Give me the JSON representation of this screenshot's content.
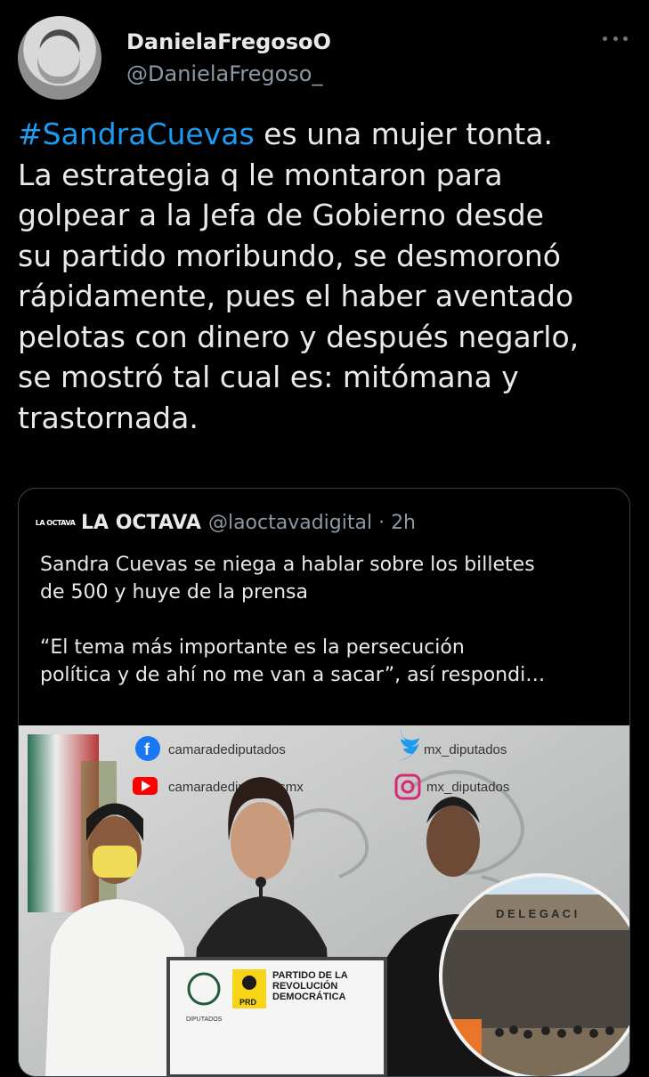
{
  "author": {
    "display_name": "DanielaFregosoO",
    "handle": "@DanielaFregoso_"
  },
  "tweet": {
    "hashtag": "#SandraCuevas",
    "text": " es una mujer tonta.\nLa estrategia q le montaron para\ngolpear a la Jefa de Gobierno desde\nsu partido moribundo, se desmoronó\nrápidamente, pues el haber aventado\npelotas con dinero y después negarlo,\nse mostró tal cual es: mitómana y\ntrastornada."
  },
  "quote": {
    "logo_text": "LA OCTAVA",
    "name": "LA OCTAVA",
    "handle": "@laoctavadigital · 2h",
    "text": "Sandra Cuevas se niega a hablar sobre los billetes\nde 500 y huye de la prensa\n\n“El tema más importante es la persecución\npolítica y de ahí no me van a sacar”, así respondi…",
    "media": {
      "facebook_handle": "camaradediputados",
      "youtube_handle": "camaradediputadosmx",
      "twitter_handle": "mx_diputados",
      "instagram_handle": "mx_diputados",
      "podium_title": "PARTIDO DE LA\nREVOLUCIÓN\nDEMOCRÁTICA",
      "podium_badge": "PRD",
      "podium_seal": "DIPUTADOS",
      "inset_sign": "D E L E G A C I"
    }
  },
  "colors": {
    "background": "#000000",
    "text": "#e7e9ea",
    "secondary": "#8b98a5",
    "link": "#1d9bf0",
    "border": "#38444d",
    "prd_yellow": "#f7d417"
  }
}
